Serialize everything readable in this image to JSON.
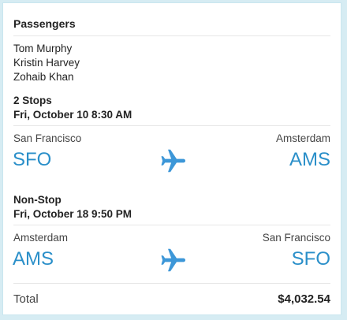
{
  "passengers": {
    "title": "Passengers",
    "names": [
      "Tom Murphy",
      "Kristin Harvey",
      "Zohaib Khan"
    ]
  },
  "flights": [
    {
      "stops": "2 Stops",
      "date": "Fri, October 10 8:30 AM",
      "from_city": "San Francisco",
      "from_code": "SFO",
      "to_city": "Amsterdam",
      "to_code": "AMS",
      "icon": "airplane-icon"
    },
    {
      "stops": "Non-Stop",
      "date": "Fri, October 18 9:50 PM",
      "from_city": "Amsterdam",
      "from_code": "AMS",
      "to_city": "San Francisco",
      "to_code": "SFO",
      "icon": "airplane-icon"
    }
  ],
  "total": {
    "label": "Total",
    "value": "$4,032.54"
  },
  "colors": {
    "accent": "#2a8fc9",
    "plane": "#3d97d8"
  }
}
